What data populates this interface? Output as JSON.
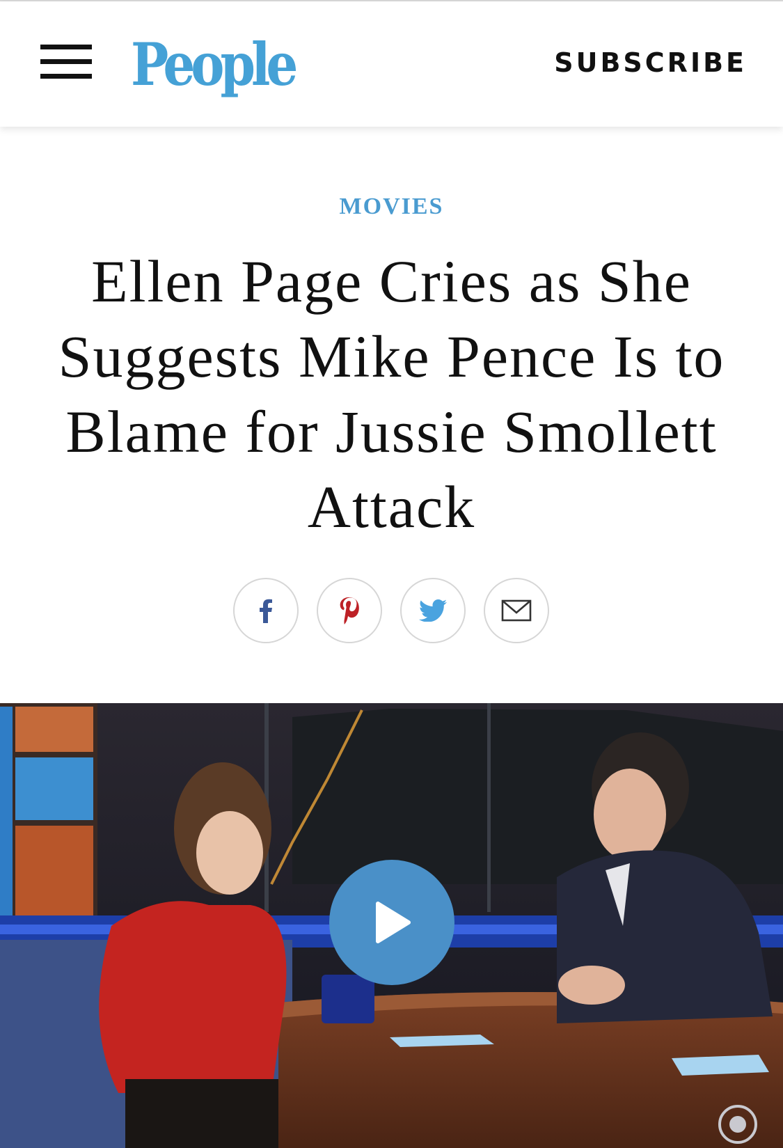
{
  "header": {
    "logo_text": "People",
    "subscribe_label": "SUBSCRIBE"
  },
  "article": {
    "category": "MOVIES",
    "headline": "Ellen Page Cries as She Suggests Mike Pence Is to Blame for Jussie Smollett Attack"
  },
  "share": {
    "buttons": [
      "facebook-icon",
      "pinterest-icon",
      "twitter-icon",
      "email-icon"
    ]
  },
  "video": {
    "play_icon": "play-icon"
  },
  "colors": {
    "brand_blue": "#45a1d6",
    "category_blue": "#4a9bd0",
    "play_blue": "#4a90c8",
    "facebook": "#3b5998",
    "pinterest": "#bd2126",
    "twitter": "#4aa3df"
  }
}
